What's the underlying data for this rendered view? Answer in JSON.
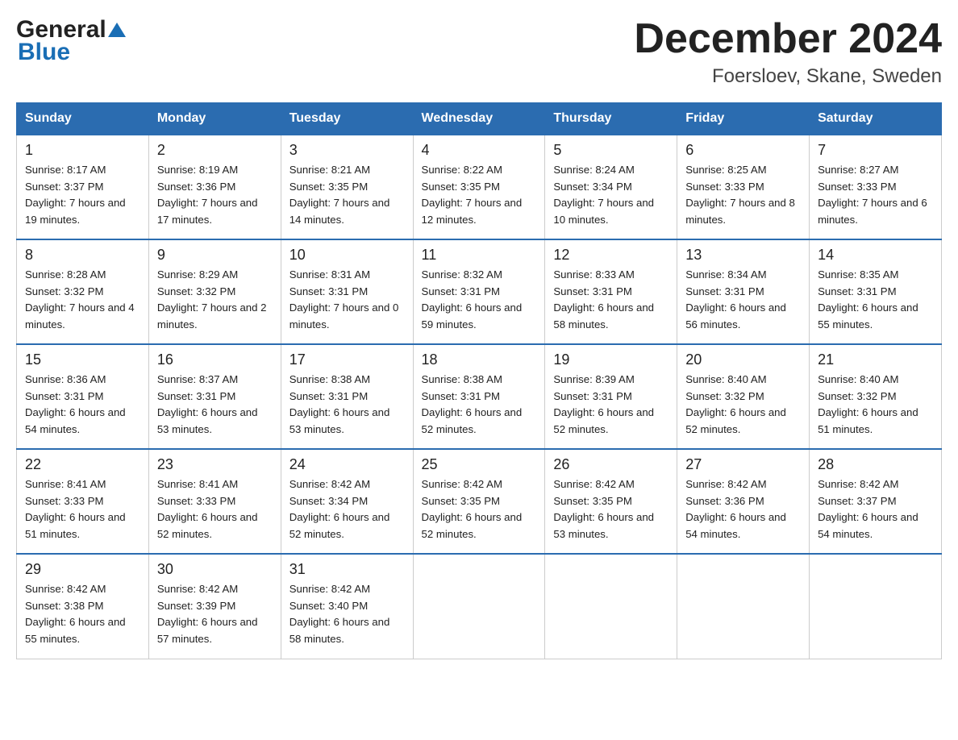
{
  "header": {
    "logo_general": "General",
    "logo_blue": "Blue",
    "month_title": "December 2024",
    "location": "Foersloev, Skane, Sweden"
  },
  "days_of_week": [
    "Sunday",
    "Monday",
    "Tuesday",
    "Wednesday",
    "Thursday",
    "Friday",
    "Saturday"
  ],
  "weeks": [
    [
      {
        "day": "1",
        "sunrise": "8:17 AM",
        "sunset": "3:37 PM",
        "daylight": "7 hours and 19 minutes."
      },
      {
        "day": "2",
        "sunrise": "8:19 AM",
        "sunset": "3:36 PM",
        "daylight": "7 hours and 17 minutes."
      },
      {
        "day": "3",
        "sunrise": "8:21 AM",
        "sunset": "3:35 PM",
        "daylight": "7 hours and 14 minutes."
      },
      {
        "day": "4",
        "sunrise": "8:22 AM",
        "sunset": "3:35 PM",
        "daylight": "7 hours and 12 minutes."
      },
      {
        "day": "5",
        "sunrise": "8:24 AM",
        "sunset": "3:34 PM",
        "daylight": "7 hours and 10 minutes."
      },
      {
        "day": "6",
        "sunrise": "8:25 AM",
        "sunset": "3:33 PM",
        "daylight": "7 hours and 8 minutes."
      },
      {
        "day": "7",
        "sunrise": "8:27 AM",
        "sunset": "3:33 PM",
        "daylight": "7 hours and 6 minutes."
      }
    ],
    [
      {
        "day": "8",
        "sunrise": "8:28 AM",
        "sunset": "3:32 PM",
        "daylight": "7 hours and 4 minutes."
      },
      {
        "day": "9",
        "sunrise": "8:29 AM",
        "sunset": "3:32 PM",
        "daylight": "7 hours and 2 minutes."
      },
      {
        "day": "10",
        "sunrise": "8:31 AM",
        "sunset": "3:31 PM",
        "daylight": "7 hours and 0 minutes."
      },
      {
        "day": "11",
        "sunrise": "8:32 AM",
        "sunset": "3:31 PM",
        "daylight": "6 hours and 59 minutes."
      },
      {
        "day": "12",
        "sunrise": "8:33 AM",
        "sunset": "3:31 PM",
        "daylight": "6 hours and 58 minutes."
      },
      {
        "day": "13",
        "sunrise": "8:34 AM",
        "sunset": "3:31 PM",
        "daylight": "6 hours and 56 minutes."
      },
      {
        "day": "14",
        "sunrise": "8:35 AM",
        "sunset": "3:31 PM",
        "daylight": "6 hours and 55 minutes."
      }
    ],
    [
      {
        "day": "15",
        "sunrise": "8:36 AM",
        "sunset": "3:31 PM",
        "daylight": "6 hours and 54 minutes."
      },
      {
        "day": "16",
        "sunrise": "8:37 AM",
        "sunset": "3:31 PM",
        "daylight": "6 hours and 53 minutes."
      },
      {
        "day": "17",
        "sunrise": "8:38 AM",
        "sunset": "3:31 PM",
        "daylight": "6 hours and 53 minutes."
      },
      {
        "day": "18",
        "sunrise": "8:38 AM",
        "sunset": "3:31 PM",
        "daylight": "6 hours and 52 minutes."
      },
      {
        "day": "19",
        "sunrise": "8:39 AM",
        "sunset": "3:31 PM",
        "daylight": "6 hours and 52 minutes."
      },
      {
        "day": "20",
        "sunrise": "8:40 AM",
        "sunset": "3:32 PM",
        "daylight": "6 hours and 52 minutes."
      },
      {
        "day": "21",
        "sunrise": "8:40 AM",
        "sunset": "3:32 PM",
        "daylight": "6 hours and 51 minutes."
      }
    ],
    [
      {
        "day": "22",
        "sunrise": "8:41 AM",
        "sunset": "3:33 PM",
        "daylight": "6 hours and 51 minutes."
      },
      {
        "day": "23",
        "sunrise": "8:41 AM",
        "sunset": "3:33 PM",
        "daylight": "6 hours and 52 minutes."
      },
      {
        "day": "24",
        "sunrise": "8:42 AM",
        "sunset": "3:34 PM",
        "daylight": "6 hours and 52 minutes."
      },
      {
        "day": "25",
        "sunrise": "8:42 AM",
        "sunset": "3:35 PM",
        "daylight": "6 hours and 52 minutes."
      },
      {
        "day": "26",
        "sunrise": "8:42 AM",
        "sunset": "3:35 PM",
        "daylight": "6 hours and 53 minutes."
      },
      {
        "day": "27",
        "sunrise": "8:42 AM",
        "sunset": "3:36 PM",
        "daylight": "6 hours and 54 minutes."
      },
      {
        "day": "28",
        "sunrise": "8:42 AM",
        "sunset": "3:37 PM",
        "daylight": "6 hours and 54 minutes."
      }
    ],
    [
      {
        "day": "29",
        "sunrise": "8:42 AM",
        "sunset": "3:38 PM",
        "daylight": "6 hours and 55 minutes."
      },
      {
        "day": "30",
        "sunrise": "8:42 AM",
        "sunset": "3:39 PM",
        "daylight": "6 hours and 57 minutes."
      },
      {
        "day": "31",
        "sunrise": "8:42 AM",
        "sunset": "3:40 PM",
        "daylight": "6 hours and 58 minutes."
      },
      null,
      null,
      null,
      null
    ]
  ]
}
